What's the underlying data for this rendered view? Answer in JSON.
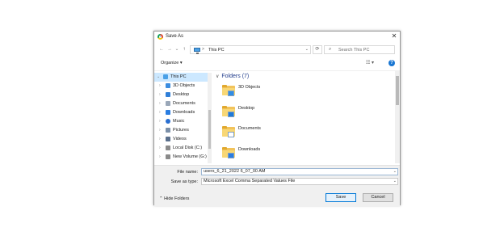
{
  "window": {
    "title": "Save As"
  },
  "address": {
    "path_label": "This PC",
    "separator": ">",
    "search_placeholder": "Search This PC"
  },
  "toolbar": {
    "organize_label": "Organize ▾"
  },
  "nav": {
    "items": [
      {
        "label": "This PC",
        "icon": "pc-icon",
        "color": "#4aa0e6"
      },
      {
        "label": "3D Objects",
        "icon": "cube-icon",
        "color": "#3b8de0"
      },
      {
        "label": "Desktop",
        "icon": "desktop-icon",
        "color": "#2f7fd8"
      },
      {
        "label": "Documents",
        "icon": "document-icon",
        "color": "#9aa7b8"
      },
      {
        "label": "Downloads",
        "icon": "download-icon",
        "color": "#2a7de1"
      },
      {
        "label": "Music",
        "icon": "music-icon",
        "color": "#2a6fd1"
      },
      {
        "label": "Pictures",
        "icon": "pictures-icon",
        "color": "#7b8fa8"
      },
      {
        "label": "Videos",
        "icon": "video-icon",
        "color": "#5a6f8c"
      },
      {
        "label": "Local Disk (C:)",
        "icon": "disk-icon",
        "color": "#8a8a8a"
      },
      {
        "label": "New Volume (G:)",
        "icon": "disk-icon",
        "color": "#8a8a8a"
      }
    ]
  },
  "content": {
    "group_label": "Folders (7)",
    "folders": [
      {
        "label": "3D Objects",
        "overlay": "cube-icon",
        "overlay_color": "#2f8de4"
      },
      {
        "label": "Desktop",
        "overlay": "desktop-icon",
        "overlay_color": "#1f7ad8"
      },
      {
        "label": "Documents",
        "overlay": "document-icon",
        "overlay_color": "#ffffff"
      },
      {
        "label": "Downloads",
        "overlay": "download-icon",
        "overlay_color": "#2a7de1"
      }
    ]
  },
  "footer": {
    "filename_label": "File name:",
    "filename_value": "users_6_21_2022 6_07_00 AM",
    "savetype_label": "Save as type:",
    "savetype_value": "Microsoft Excel Comma Separated Values File",
    "hide_folders_label": "Hide Folders",
    "save_label": "Save",
    "cancel_label": "Cancel"
  }
}
